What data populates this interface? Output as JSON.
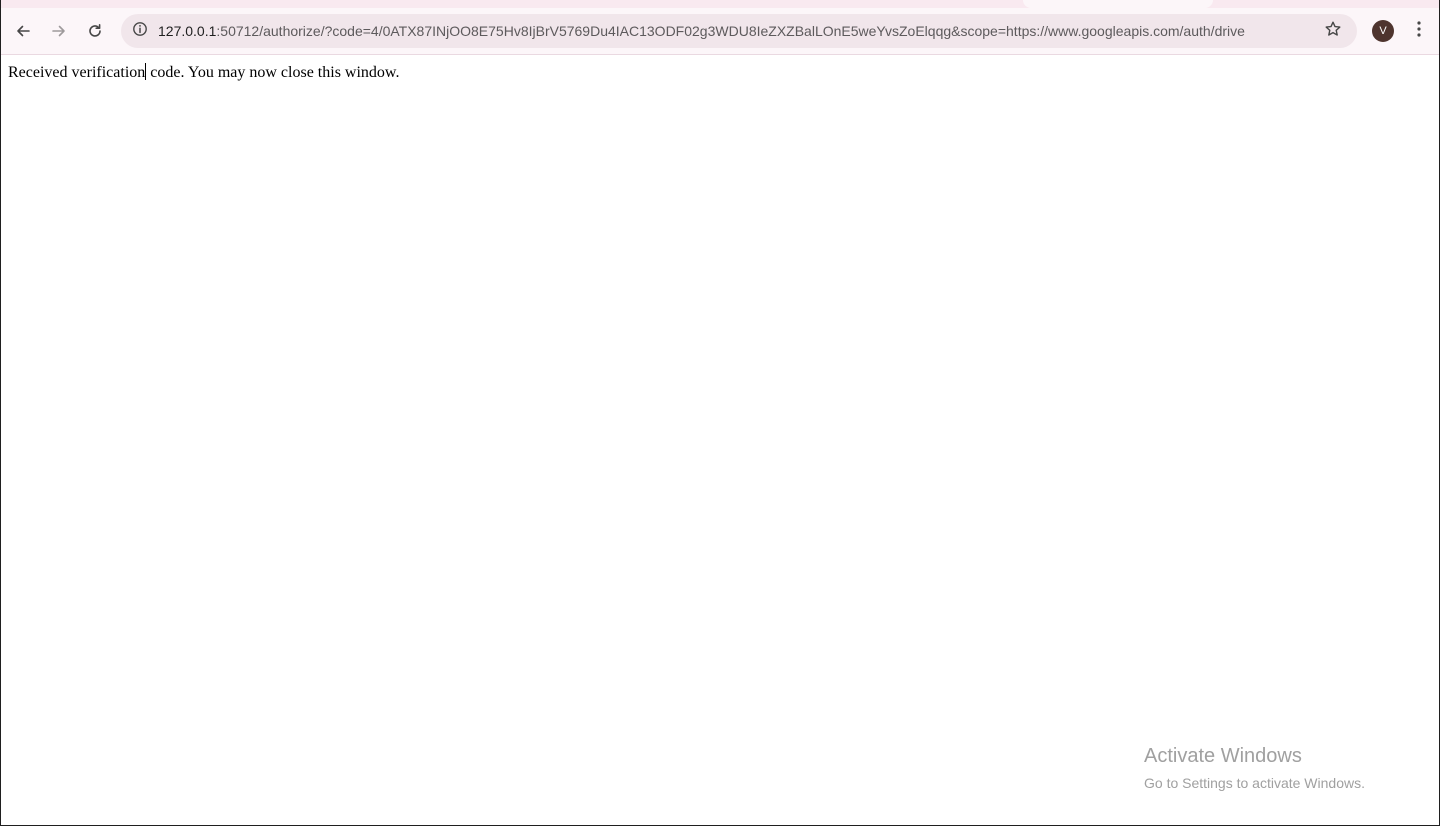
{
  "browser": {
    "url_host": "127.0.0.1",
    "url_rest": ":50712/authorize/?code=4/0ATX87INjOO8E75Hv8IjBrV5769Du4IAC13ODF02g3WDU8IeZXZBalLOnE5weYvsZoElqqg&scope=https://www.googleapis.com/auth/drive",
    "profile_initial": "V",
    "icons": {
      "back": "back-arrow-icon",
      "forward": "forward-arrow-icon",
      "reload": "reload-icon",
      "site_info": "info-icon",
      "bookmark": "star-icon",
      "menu": "three-dot-menu-icon"
    },
    "colors": {
      "tabstrip": "#f9e9f0",
      "toolbar": "#fcf6f9",
      "omnibox": "#f1e6eb",
      "avatar": "#4e342e"
    }
  },
  "page": {
    "message_before_caret": "Received verification",
    "message_after_caret": " code. You may now close this window."
  },
  "watermark": {
    "title": "Activate Windows",
    "subtitle": "Go to Settings to activate Windows."
  }
}
